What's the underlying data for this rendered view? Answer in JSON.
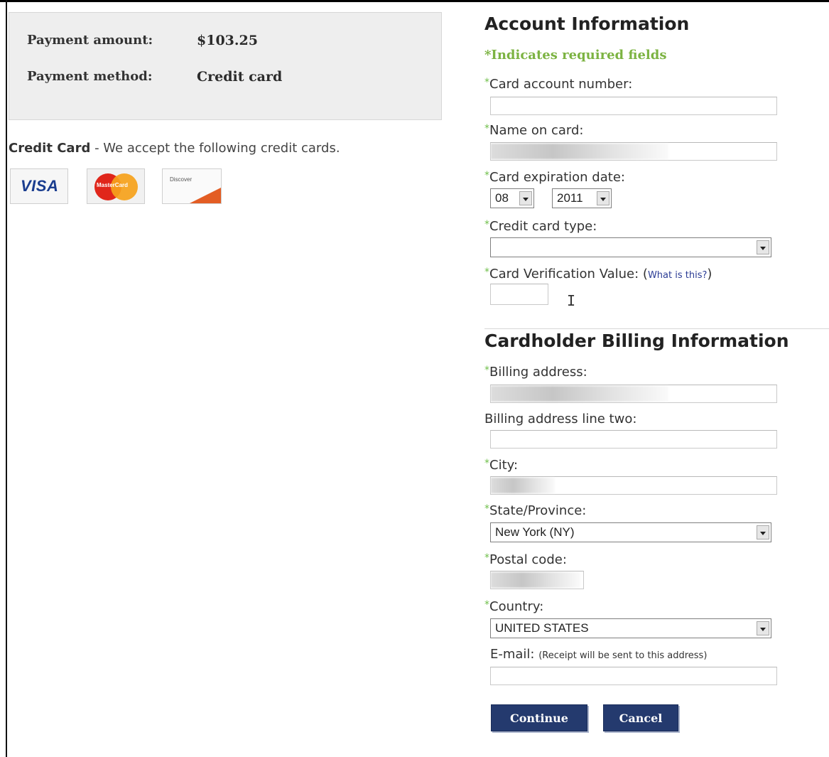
{
  "summary": {
    "amount_label": "Payment amount:",
    "amount_value": "$103.25",
    "method_label": "Payment method:",
    "method_value": "Credit card"
  },
  "credit_card": {
    "title": "Credit Card",
    "description": " - We accept the following credit cards.",
    "logos": {
      "visa": "VISA",
      "mastercard": "MasterCard",
      "discover": "Discover"
    }
  },
  "account": {
    "heading": "Account Information",
    "required_note": "*Indicates required fields",
    "required_marker": "*",
    "card_number_label": "Card account number:",
    "card_number_value": "",
    "name_label": "Name on card:",
    "expiration_label": "Card expiration date:",
    "exp_month": "08",
    "exp_year": "2011",
    "card_type_label": "Credit card type:",
    "card_type_value": "",
    "cvv_label": "Card Verification Value: (",
    "cvv_link": "What is this?",
    "cvv_close": ")",
    "cvv_value": ""
  },
  "billing": {
    "heading": "Cardholder Billing Information",
    "address_label": "Billing address:",
    "address2_label": "Billing address line two:",
    "address2_value": "",
    "city_label": "City:",
    "state_label": "State/Province:",
    "state_value": "New York (NY)",
    "postal_label": "Postal code:",
    "country_label": "Country:",
    "country_value": "UNITED STATES",
    "email_label": "E-mail: ",
    "email_note": "(Receipt will be sent to this address)",
    "email_value": ""
  },
  "buttons": {
    "continue": "Continue",
    "cancel": "Cancel"
  },
  "colors": {
    "required_green": "#7cb342",
    "button_navy": "#243a6e",
    "link_blue": "#2b3c95"
  }
}
